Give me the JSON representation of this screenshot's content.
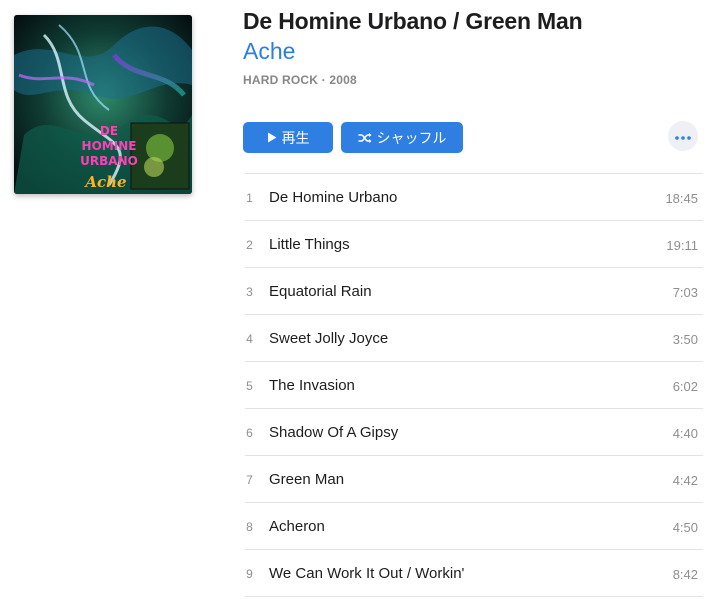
{
  "album": {
    "title": "De Homine Urbano / Green Man",
    "artist": "Ache",
    "meta": "HARD ROCK · 2008",
    "cover_text": [
      "DE",
      "HOMINE",
      "URBANO"
    ],
    "cover_logo": "Ache"
  },
  "actions": {
    "play_label": "再生",
    "shuffle_label": "シャッフル",
    "accent_color": "#2f7fe3",
    "link_color": "#2b7de9"
  },
  "tracks": [
    {
      "number": "1",
      "name": "De Homine Urbano",
      "duration": "18:45"
    },
    {
      "number": "2",
      "name": "Little Things",
      "duration": "19:11"
    },
    {
      "number": "3",
      "name": "Equatorial Rain",
      "duration": "7:03"
    },
    {
      "number": "4",
      "name": "Sweet Jolly Joyce",
      "duration": "3:50"
    },
    {
      "number": "5",
      "name": "The Invasion",
      "duration": "6:02"
    },
    {
      "number": "6",
      "name": "Shadow Of A Gipsy",
      "duration": "4:40"
    },
    {
      "number": "7",
      "name": "Green Man",
      "duration": "4:42"
    },
    {
      "number": "8",
      "name": "Acheron",
      "duration": "4:50"
    },
    {
      "number": "9",
      "name": "We Can Work It Out / Workin'",
      "duration": "8:42"
    }
  ],
  "icons": {
    "play": "play-icon",
    "shuffle": "shuffle-icon",
    "more": "ellipsis-icon"
  }
}
